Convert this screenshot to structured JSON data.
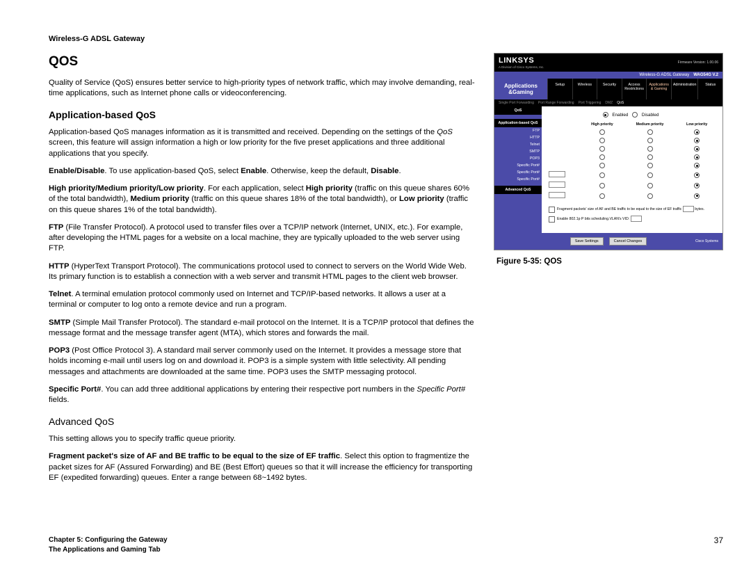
{
  "header": "Wireless-G ADSL Gateway",
  "title": "QOS",
  "intro": "Quality of Service (QoS) ensures better service to high-priority types of network traffic, which may involve demanding, real-time applications, such as Internet phone calls or videoconferencing.",
  "appqos_title": "Application-based QoS",
  "appqos_p1a": "Application-based QoS manages information as it is transmitted and received. Depending on the settings of the ",
  "appqos_p1b": "QoS",
  "appqos_p1c": " screen, this feature will assign information a high or low priority for the five preset applications and three additional applications that you specify.",
  "enable_b1": "Enable/Disable",
  "enable_t1": ". To use application-based QoS, select ",
  "enable_b2": "Enable",
  "enable_t2": ". Otherwise, keep the default, ",
  "enable_b3": "Disable",
  "enable_t3": ".",
  "prio_b1": "High priority/Medium priority/Low priority",
  "prio_t1": ". For each application, select ",
  "prio_b2": "High priority",
  "prio_t2": " (traffic on this queue shares 60% of the total bandwidth), ",
  "prio_b3": "Medium priority",
  "prio_t3": " (traffic on this queue shares 18% of the total bandwidth), or ",
  "prio_b4": "Low priority",
  "prio_t4": " (traffic on this queue shares 1% of the total bandwidth).",
  "ftp_b": "FTP",
  "ftp_t": " (File Transfer Protocol). A protocol used to transfer files over a TCP/IP network (Internet, UNIX, etc.). For example, after developing the HTML pages for a website on a local machine, they are typically uploaded to the web server using FTP.",
  "http_b": "HTTP",
  "http_t": " (HyperText Transport Protocol). The communications protocol used to connect to servers on the World Wide Web. Its primary function is to establish a connection with a web server and transmit HTML pages to the client web browser.",
  "telnet_b": "Telnet",
  "telnet_t": ". A terminal emulation protocol commonly used on Internet and TCP/IP-based networks. It allows a user at a terminal or computer to log onto a remote device and run a program.",
  "smtp_b": "SMTP",
  "smtp_t": " (Simple Mail Transfer Protocol). The standard e-mail protocol on the Internet. It is a TCP/IP protocol that defines the message format and the message transfer agent (MTA), which stores and forwards the mail.",
  "pop3_b": "POP3",
  "pop3_t": " (Post Office Protocol 3). A standard mail server commonly used on the Internet. It provides a message store that holds incoming e-mail until users log on and download it. POP3 is a simple system with little selectivity. All pending messages and attachments are downloaded at the same time. POP3 uses the SMTP messaging protocol.",
  "sp_b": "Specific Port#",
  "sp_t1": ". You can add three additional applications by entering their respective port numbers in the ",
  "sp_i": "Specific Port#",
  "sp_t2": " fields.",
  "advqos_title": "Advanced QoS",
  "advqos_p1a": "This setting allows you to ",
  "advqos_p1b": "specify traffic queue priority.",
  "frag_b": "Fragment packet's size of AF and BE traffic to be equal to the size of EF traffic",
  "frag_t": ". Select this option to fragmentize the packet sizes for AF (Assured Forwarding) and BE (Best Effort) queues so that it will increase the efficiency for transporting EF (expedited forwarding) queues.  Enter a range between 68~1492 bytes.",
  "figure_caption": "Figure 5-35: QOS",
  "router": {
    "logo": "LINKSYS",
    "logo_sub": "A Division of Cisco Systems, Inc.",
    "firmware": "Firmware Version: 1.00.06",
    "product": "Wireless-G ADSL Gateway",
    "model": "WAG54G V.2",
    "section": "Applications &Gaming",
    "tabs": [
      "Setup",
      "Wireless",
      "Security",
      "Access Restrictions",
      "Applications & Gaming",
      "Administration",
      "Status"
    ],
    "subnav": [
      "Single Port Forwarding",
      "Port Range Forwarding",
      "Port Triggering",
      "DMZ",
      "QoS"
    ],
    "side_hdr": "QoS",
    "side_app": "Application-based QoS",
    "side_adv": "Advanced QoS",
    "enabled": "Enabled",
    "disabled": "Disabled",
    "col_high": "High priority",
    "col_med": "Medium priority",
    "col_low": "Low priority",
    "rows": [
      "FTP",
      "HTTP",
      "Telnet",
      "SMTP",
      "POP3",
      "Specific Port#",
      "Specific Port#",
      "Specific Port#"
    ],
    "adv1": "Fragment packets' size of AF and BE traffic to be equal to the size of EF traffic",
    "adv1b": "bytes.",
    "adv2": "Enable 802.1p P bits scheduling.VLAN's VID:",
    "btn_save": "Save Settings",
    "btn_cancel": "Cancel Changes",
    "cisco": "Cisco Systems"
  },
  "footer": {
    "ch": "Chapter 5: Configuring the Gateway",
    "sec": "The Applications and Gaming Tab",
    "page": "37"
  }
}
